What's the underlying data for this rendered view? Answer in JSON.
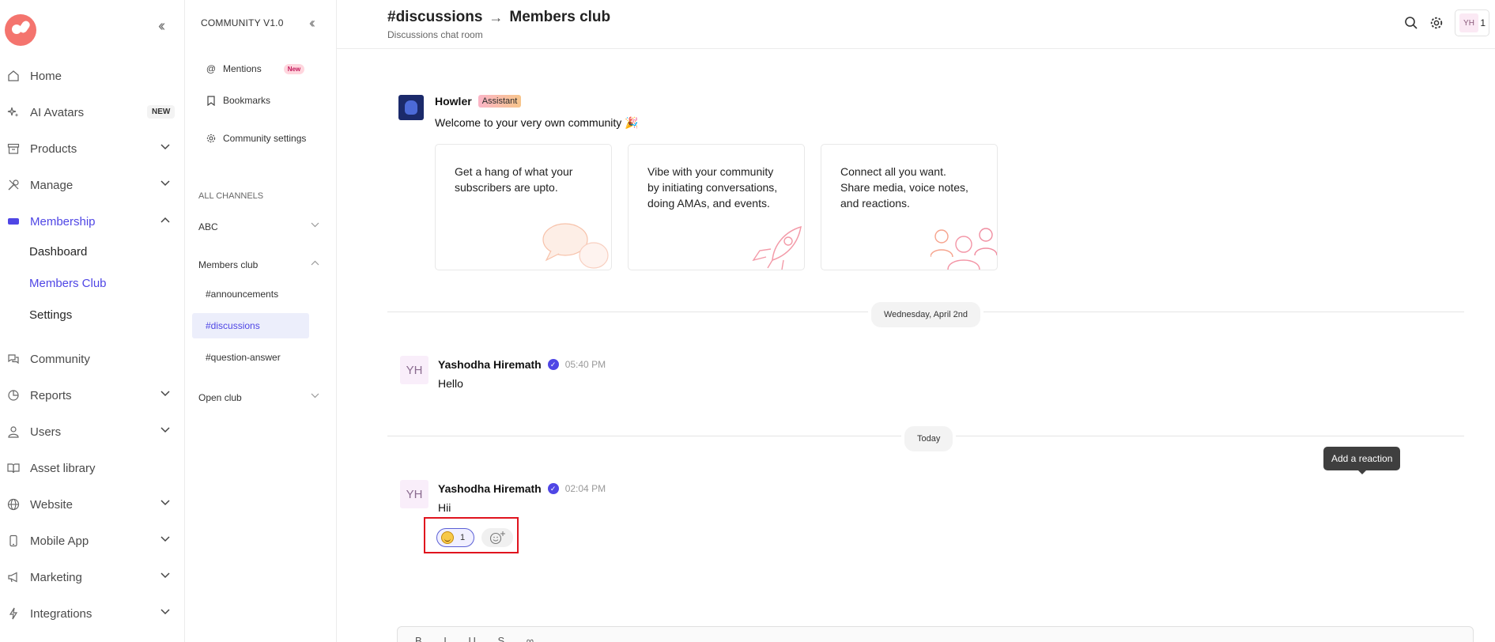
{
  "sidebar": {
    "items": [
      {
        "label": "Home",
        "icon": "home-icon"
      },
      {
        "label": "AI Avatars",
        "icon": "sparkles-icon",
        "badge": "NEW"
      },
      {
        "label": "Products",
        "icon": "archive-icon"
      },
      {
        "label": "Manage",
        "icon": "tools-icon"
      },
      {
        "label": "Membership",
        "icon": "ticket-icon"
      },
      {
        "label": "Community",
        "icon": "chat-icon"
      },
      {
        "label": "Reports",
        "icon": "pie-chart-icon"
      },
      {
        "label": "Users",
        "icon": "user-icon"
      },
      {
        "label": "Asset library",
        "icon": "book-icon"
      },
      {
        "label": "Website",
        "icon": "globe-icon"
      },
      {
        "label": "Mobile App",
        "icon": "phone-icon"
      },
      {
        "label": "Marketing",
        "icon": "megaphone-icon"
      },
      {
        "label": "Integrations",
        "icon": "plug-icon"
      }
    ],
    "membership_sub": [
      "Dashboard",
      "Members Club",
      "Settings"
    ],
    "active_color": "#4f46e5"
  },
  "community_panel": {
    "title": "COMMUNITY V1.0",
    "mentions": "Mentions",
    "mentions_badge": "New",
    "bookmarks": "Bookmarks",
    "settings": "Community settings",
    "section_label": "ALL CHANNELS",
    "groups": [
      "ABC",
      "Members club",
      "Open club"
    ],
    "channels": [
      "#announcements",
      "#discussions",
      "#question-answer"
    ]
  },
  "header": {
    "channel": "#discussions",
    "club": "Members club",
    "subtitle": "Discussions chat room",
    "avatar_initials": "YH",
    "avatar_count": "1"
  },
  "welcome": {
    "bot_name": "Howler",
    "bot_badge": "Assistant",
    "text": "Welcome to your very own community 🎉",
    "cards": [
      "Get a hang of what your subscribers are upto.",
      "Vibe with your community by initiating conversations, doing AMAs, and events.",
      "Connect all you want. Share media, voice notes, and reactions."
    ]
  },
  "dividers": {
    "first": "Wednesday, April 2nd",
    "second": "Today"
  },
  "messages": [
    {
      "initials": "YH",
      "author": "Yashodha Hiremath",
      "time": "05:40 PM",
      "text": "Hello"
    },
    {
      "initials": "YH",
      "author": "Yashodha Hiremath",
      "time": "02:04 PM",
      "text": "Hii"
    }
  ],
  "reaction": {
    "count": "1",
    "emoji": "smile-emoji"
  },
  "tooltip": "Add a reaction",
  "composer_tools": "B I U S ∞"
}
